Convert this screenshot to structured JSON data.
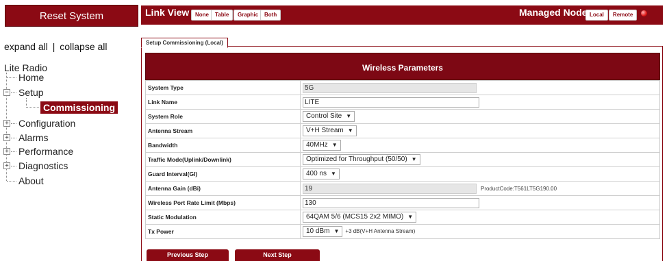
{
  "left_panel": {
    "reset_label": "Reset System",
    "expand_all": "expand all",
    "separator": "|",
    "collapse_all": "collapse all",
    "tree": {
      "root": "Lite Radio",
      "home": "Home",
      "setup": "Setup",
      "commissioning": "Commissioning",
      "configuration": "Configuration",
      "alarms": "Alarms",
      "performance": "Performance",
      "diagnostics": "Diagnostics",
      "about": "About"
    }
  },
  "topbar": {
    "link_view_label": "Link View",
    "link_view_options": [
      "None",
      "Table",
      "Graphic",
      "Both"
    ],
    "managed_node_label": "Managed Node",
    "managed_node_options": [
      "Local",
      "Remote"
    ]
  },
  "tab": {
    "label": "Setup Commissioning (Local)"
  },
  "params": {
    "title": "Wireless Parameters",
    "rows": {
      "system_type": {
        "label": "System Type",
        "value": "5G"
      },
      "link_name": {
        "label": "Link Name",
        "value": "LITE"
      },
      "system_role": {
        "label": "System Role",
        "value": "Control Site"
      },
      "antenna_stream": {
        "label": "Antenna Stream",
        "value": "V+H Stream"
      },
      "bandwidth": {
        "label": "Bandwidth",
        "value": "40MHz"
      },
      "traffic_mode": {
        "label": "Traffic Mode(Uplink/Downlink)",
        "value": "Optimized for Throughput (50/50)"
      },
      "guard_interval": {
        "label": "Guard Interval(GI)",
        "value": "400 ns"
      },
      "antenna_gain": {
        "label": "Antenna Gain (dBi)",
        "value": "19",
        "aside": "ProductCode:T561LT5G190.00"
      },
      "port_rate": {
        "label": "Wireless Port Rate Limit (Mbps)",
        "value": "130"
      },
      "static_modulation": {
        "label": "Static Modulation",
        "value": "64QAM 5/6 (MCS15 2x2 MIMO)"
      },
      "tx_power": {
        "label": "Tx Power",
        "value": "10 dBm",
        "note": "+3 dB(V+H Antenna Stream)"
      }
    }
  },
  "footer": {
    "previous_label": "Previous Step",
    "next_label": "Next Step"
  },
  "colors": {
    "brand": "#8b0a14",
    "header": "#7d0814",
    "status_dot": "#e01818"
  }
}
